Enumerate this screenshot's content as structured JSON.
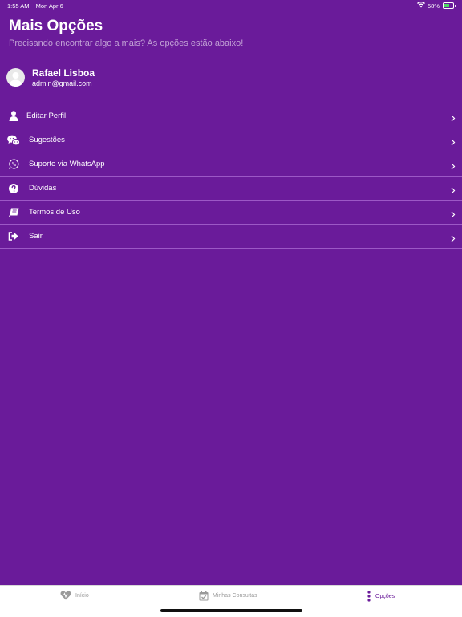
{
  "status": {
    "time": "1:55 AM",
    "date": "Mon Apr 6",
    "battery": "58%",
    "battery_level": 0.58
  },
  "header": {
    "title": "Mais Opções",
    "subtitle": "Precisando encontrar algo a mais? As opções estão abaixo!"
  },
  "profile": {
    "name": "Rafael Lisboa",
    "email": "admin@gmail.com"
  },
  "menu": [
    {
      "label": "Editar Perfil",
      "icon": "user-icon"
    },
    {
      "label": "Sugestões",
      "icon": "chat-bubbles-icon"
    },
    {
      "label": "Suporte via WhatsApp",
      "icon": "whatsapp-icon"
    },
    {
      "label": "Dúvidas",
      "icon": "question-circle-icon"
    },
    {
      "label": "Termos de Uso",
      "icon": "book-icon"
    },
    {
      "label": "Sair",
      "icon": "sign-out-icon"
    }
  ],
  "tabs": [
    {
      "label": "Início",
      "icon": "heartbeat-icon",
      "active": false
    },
    {
      "label": "Minhas Consultas",
      "icon": "calendar-check-icon",
      "active": false
    },
    {
      "label": "Opções",
      "icon": "more-vertical-icon",
      "active": true
    }
  ],
  "colors": {
    "background": "#6a1b9a",
    "tab_active": "#6a1b9a",
    "tab_inactive": "#9a9a9a"
  }
}
